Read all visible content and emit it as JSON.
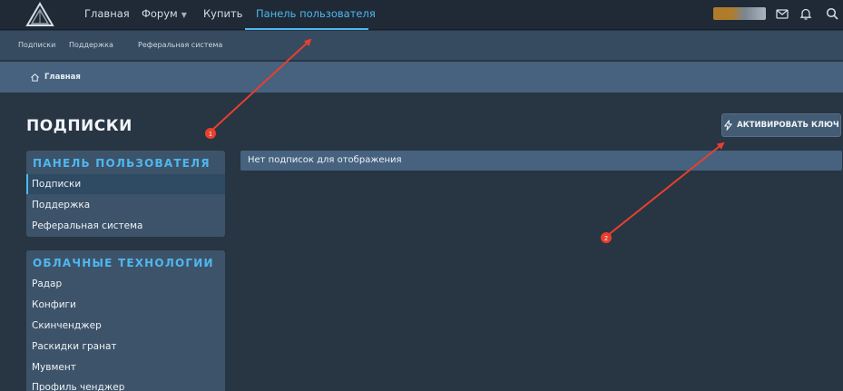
{
  "nav": {
    "items": [
      {
        "label": "Главная"
      },
      {
        "label": "Форум"
      },
      {
        "label": "Купить"
      },
      {
        "label": "Панель пользователя"
      }
    ]
  },
  "subnav": {
    "items": [
      {
        "label": "Подписки"
      },
      {
        "label": "Поддержка"
      },
      {
        "label": "Реферальная система"
      }
    ]
  },
  "breadcrumb": {
    "label": "Главная"
  },
  "page": {
    "title": "ПОДПИСКИ"
  },
  "activate": {
    "label": "АКТИВИРОВАТЬ КЛЮЧ"
  },
  "sidebar": {
    "group1": {
      "heading": "ПАНЕЛЬ ПОЛЬЗОВАТЕЛЯ",
      "items": [
        {
          "label": "Подписки"
        },
        {
          "label": "Поддержка"
        },
        {
          "label": "Реферальная система"
        }
      ]
    },
    "group2": {
      "heading": "ОБЛАЧНЫЕ ТЕХНОЛОГИИ",
      "items": [
        {
          "label": "Радар"
        },
        {
          "label": "Конфиги"
        },
        {
          "label": "Скинченджер"
        },
        {
          "label": "Раскидки гранат"
        },
        {
          "label": "Мувмент"
        },
        {
          "label": "Профиль ченджер"
        }
      ]
    }
  },
  "content": {
    "empty_message": "Нет подписок для отображения"
  },
  "annotations": [
    {
      "label": "1"
    },
    {
      "label": "2"
    }
  ],
  "colors": {
    "accent": "#4fb7f0",
    "annotation": "#e8402d"
  }
}
